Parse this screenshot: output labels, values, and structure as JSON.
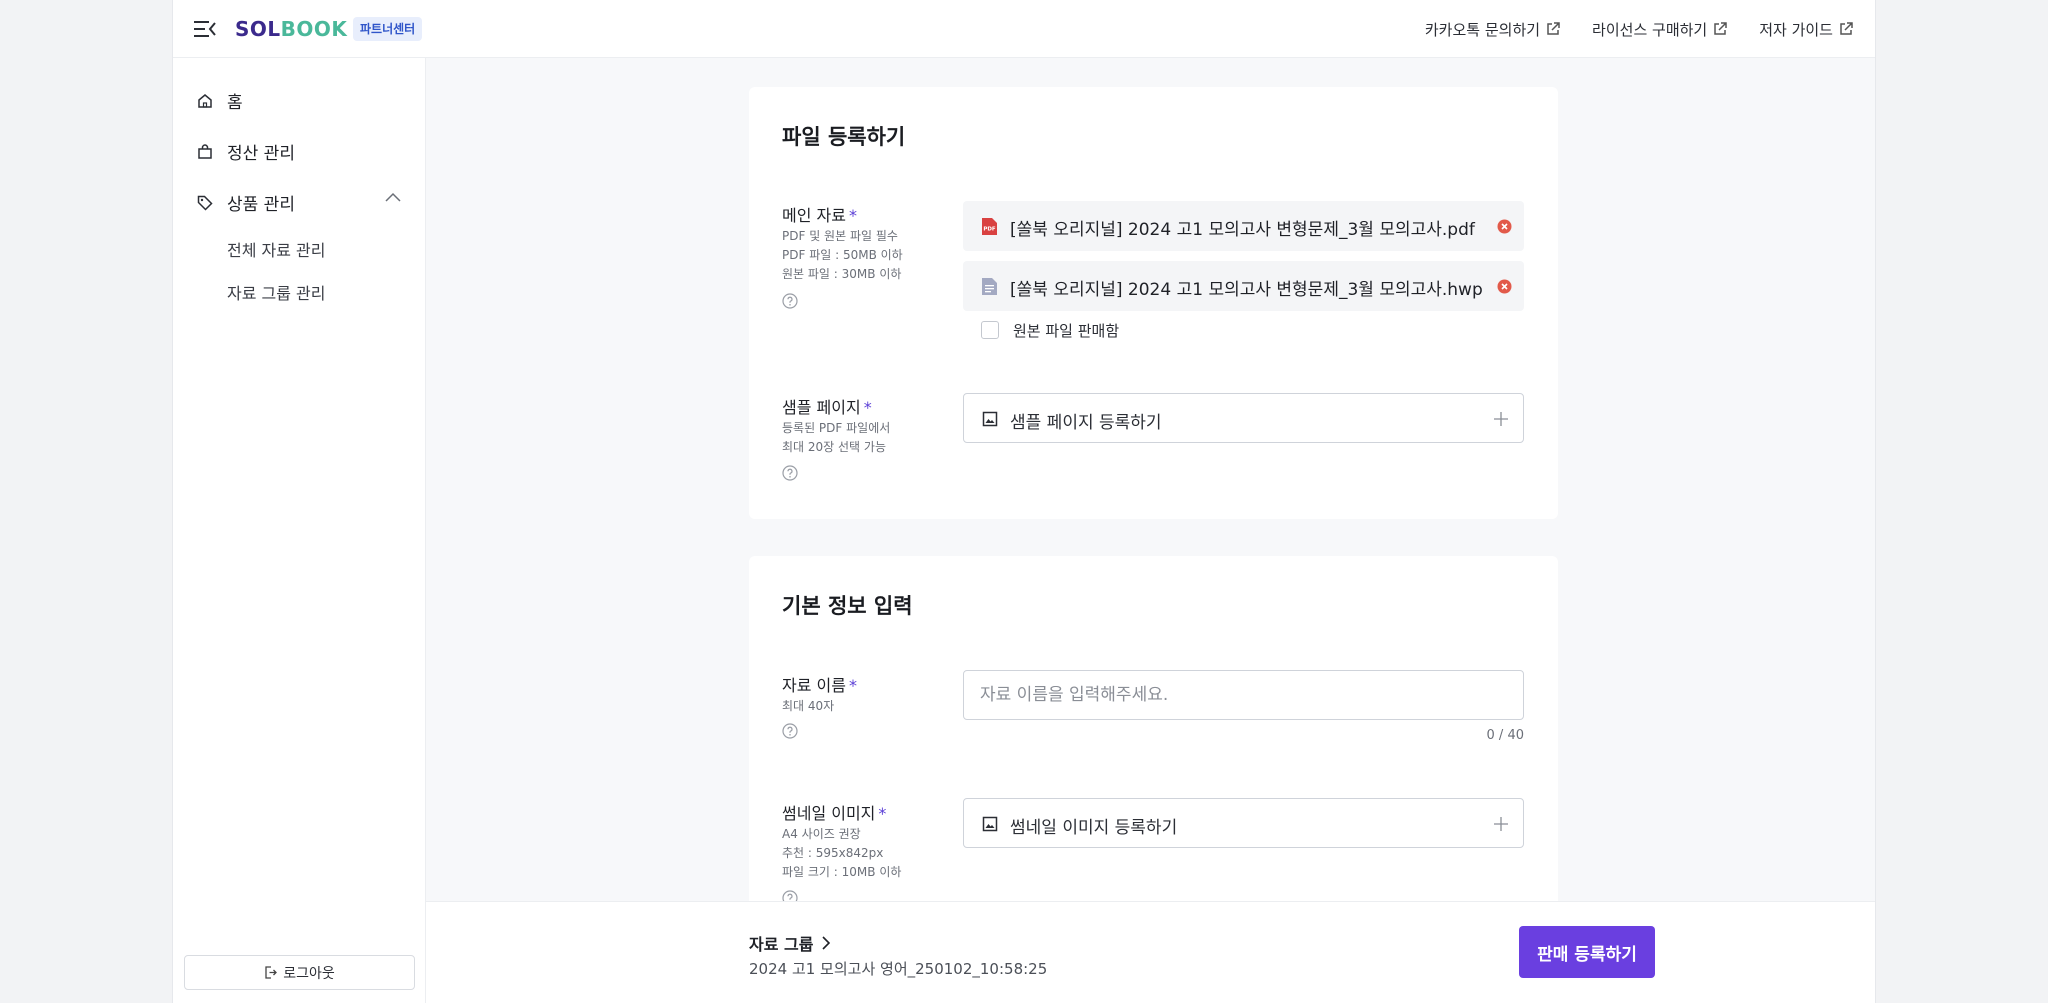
{
  "header": {
    "logo_part1": "SOL",
    "logo_part2": "BOOK",
    "badge": "파트너센터",
    "links": [
      {
        "label": "카카오톡 문의하기"
      },
      {
        "label": "라이선스 구매하기"
      },
      {
        "label": "저자 가이드"
      }
    ]
  },
  "sidebar": {
    "items": [
      {
        "label": "홈",
        "icon": "home-icon"
      },
      {
        "label": "정산 관리",
        "icon": "bag-icon"
      },
      {
        "label": "상품 관리",
        "icon": "tag-icon"
      }
    ],
    "sub_items": [
      {
        "label": "전체 자료 관리"
      },
      {
        "label": "자료 그룹 관리"
      }
    ],
    "logout_label": "로그아웃"
  },
  "file_card": {
    "title": "파일 등록하기",
    "main_label": "메인 자료",
    "main_help": [
      "PDF 및 원본 파일 필수",
      "PDF 파일 : 50MB 이하",
      "원본 파일 : 30MB 이하"
    ],
    "files": [
      {
        "name": "[쏠북 오리지널] 2024 고1 모의고사 변형문제_3월 모의고사.pdf",
        "icon": "pdf-file-icon"
      },
      {
        "name": "[쏠북 오리지널] 2024 고1 모의고사 변형문제_3월 모의고사.hwp",
        "icon": "document-file-icon"
      }
    ],
    "checkbox_label": "원본 파일 판매함",
    "sample_label": "샘플 페이지",
    "sample_help": [
      "등록된 PDF 파일에서",
      "최대 20장 선택 가능"
    ],
    "sample_upload": "샘플 페이지 등록하기"
  },
  "info_card": {
    "title": "기본 정보 입력",
    "name_label": "자료 이름",
    "name_help": "최대 40자",
    "name_placeholder": "자료 이름을 입력해주세요.",
    "name_counter": "0 / 40",
    "thumb_label": "썸네일 이미지",
    "thumb_help": [
      "A4 사이즈 권장",
      "추천 : 595x842px",
      "파일 크기 : 10MB 이하"
    ],
    "thumb_upload": "썸네일 이미지 등록하기"
  },
  "bottom": {
    "group_label": "자료 그룹",
    "group_value": "2024 고1 모의고사 영어_250102_10:58:25",
    "submit_label": "판매 등록하기"
  },
  "colors": {
    "accent": "#6a3fe0",
    "required": "#5b3fd6",
    "remove": "#e25a4a",
    "pdf": "#d94141"
  }
}
